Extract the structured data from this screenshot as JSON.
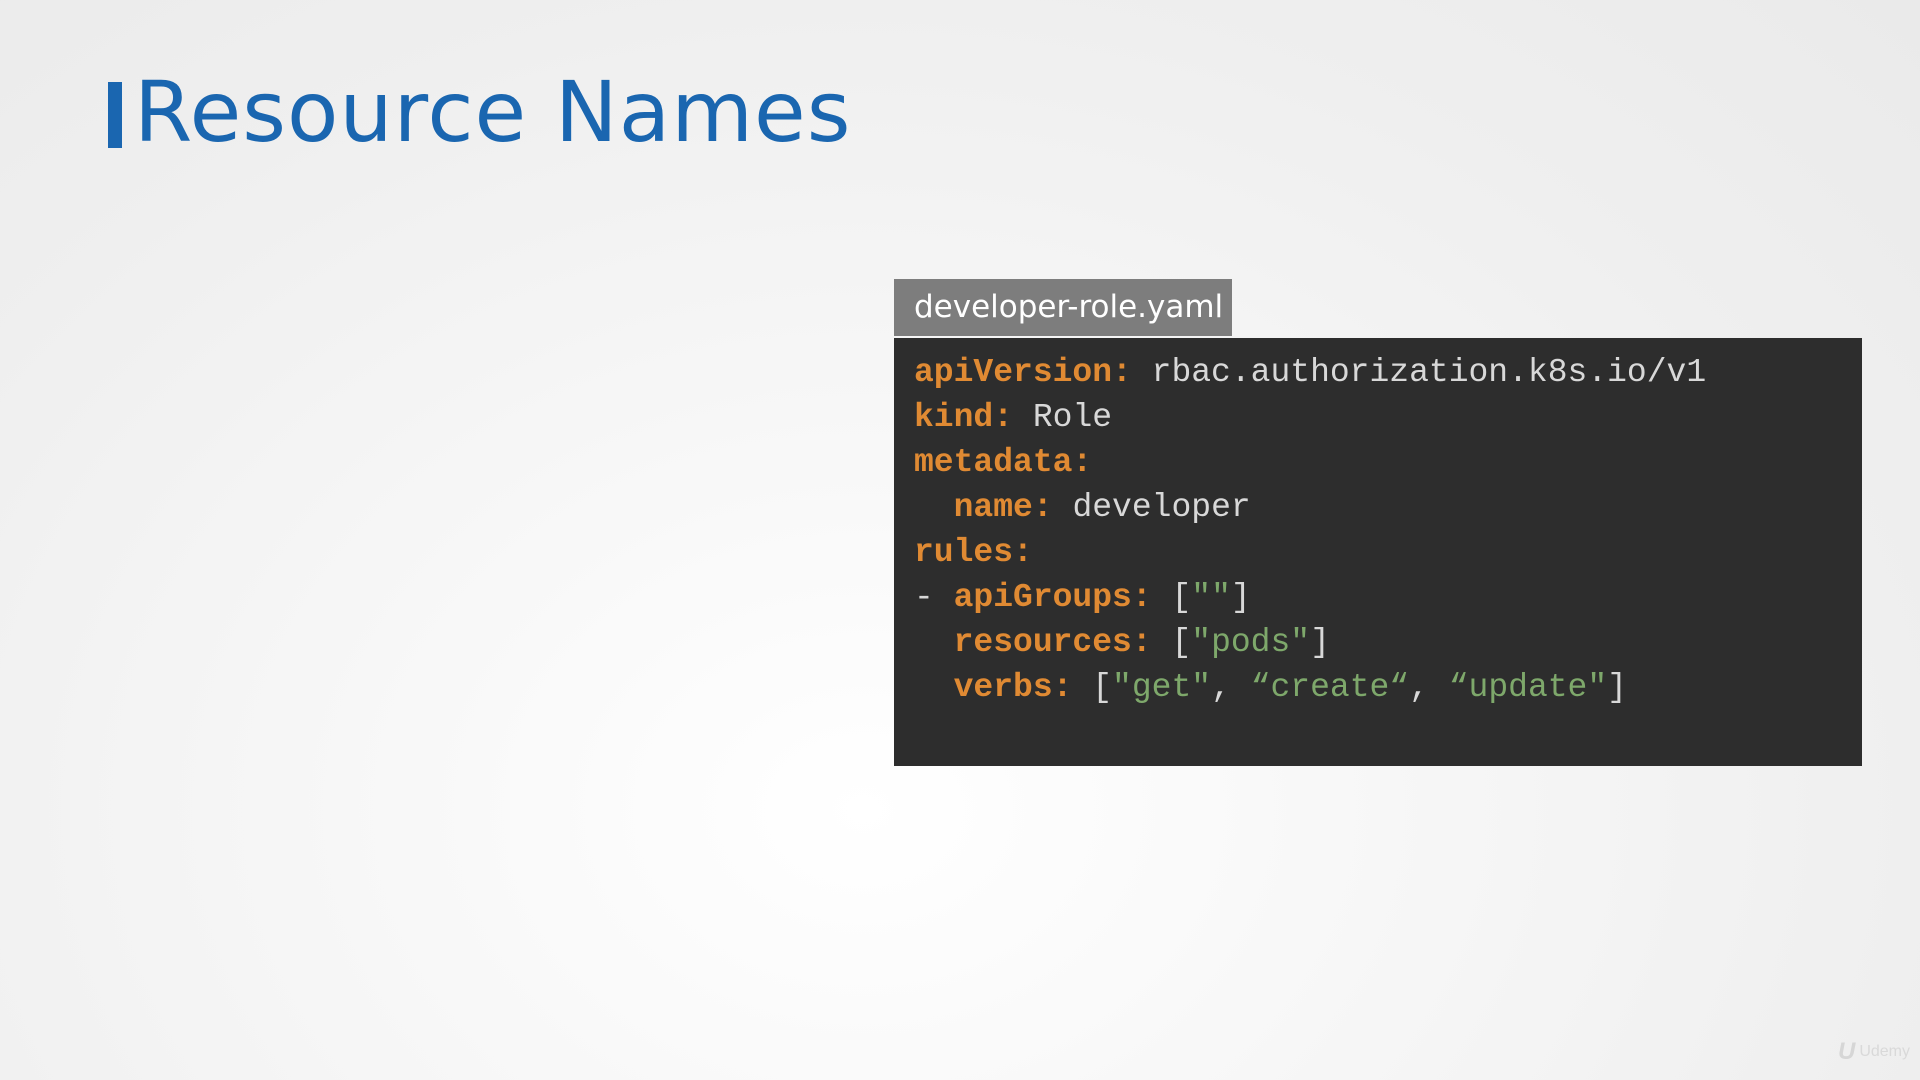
{
  "slide": {
    "title": "Resource Names",
    "accent_color": "#1a66b0"
  },
  "file_tab": {
    "filename": "developer-role.yaml"
  },
  "code": {
    "key_color": "#e08a33",
    "value_color": "#d8d8d8",
    "string_color": "#7ea86b",
    "background": "#2d2d2d",
    "lines": [
      [
        {
          "t": "apiVersion:",
          "c": "k"
        },
        {
          "t": " rbac.authorization.k8s.io/v1",
          "c": "v"
        }
      ],
      [
        {
          "t": "kind:",
          "c": "k"
        },
        {
          "t": " Role",
          "c": "v"
        }
      ],
      [
        {
          "t": "metadata:",
          "c": "k"
        }
      ],
      [
        {
          "t": "  ",
          "c": "v"
        },
        {
          "t": "name:",
          "c": "k"
        },
        {
          "t": " developer",
          "c": "v"
        }
      ],
      [
        {
          "t": "rules:",
          "c": "k"
        }
      ],
      [
        {
          "t": "- ",
          "c": "v"
        },
        {
          "t": "apiGroups:",
          "c": "k"
        },
        {
          "t": " [",
          "c": "p"
        },
        {
          "t": "\"\"",
          "c": "s"
        },
        {
          "t": "]",
          "c": "p"
        }
      ],
      [
        {
          "t": "  ",
          "c": "v"
        },
        {
          "t": "resources:",
          "c": "k"
        },
        {
          "t": " [",
          "c": "p"
        },
        {
          "t": "\"pods\"",
          "c": "s"
        },
        {
          "t": "]",
          "c": "p"
        }
      ],
      [
        {
          "t": "  ",
          "c": "v"
        },
        {
          "t": "verbs:",
          "c": "k"
        },
        {
          "t": " [",
          "c": "p"
        },
        {
          "t": "\"get\"",
          "c": "s"
        },
        {
          "t": ", ",
          "c": "p"
        },
        {
          "t": "“create“",
          "c": "s"
        },
        {
          "t": ", ",
          "c": "p"
        },
        {
          "t": "“update\"",
          "c": "s"
        },
        {
          "t": "]",
          "c": "p"
        }
      ]
    ]
  },
  "watermark": {
    "logo_icon": "udemy-logo-icon",
    "logo_glyph": "U",
    "text": "Udemy"
  }
}
